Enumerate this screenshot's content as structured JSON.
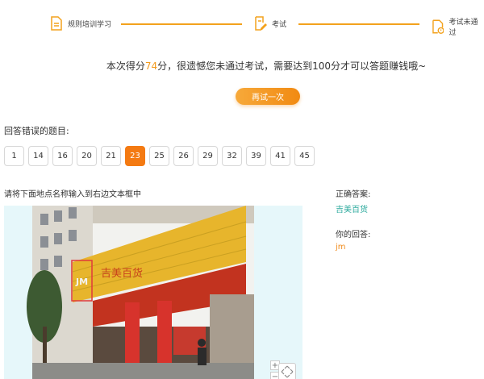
{
  "steps": [
    {
      "label": "规则培训学习"
    },
    {
      "label": "考试"
    },
    {
      "label": "考试未通过"
    }
  ],
  "result": {
    "prefix": "本次得分",
    "score": "74",
    "suffix": "分，很遗憾您未通过考试，需要达到100分才可以答题赚钱哦~",
    "retry_label": "再试一次"
  },
  "wrong": {
    "title": "回答错误的题目:",
    "items": [
      "1",
      "14",
      "16",
      "20",
      "21",
      "23",
      "25",
      "26",
      "29",
      "32",
      "39",
      "41",
      "45"
    ],
    "active": "23"
  },
  "question": {
    "prompt": "请将下面地点名称输入到右边文本框中",
    "sign_text": "吉美百货",
    "highlight_text": "JM"
  },
  "answer": {
    "correct_label": "正确答案:",
    "correct_value": "吉美百货",
    "user_label": "你的回答:",
    "user_value": "jm"
  },
  "map_controls": {
    "zoom_in": "+",
    "zoom_out": "−"
  },
  "colors": {
    "accent": "#f39a1c",
    "active": "#f47a12",
    "teal": "#2aa99c"
  },
  "icons": [
    "document-icon",
    "edit-icon",
    "doc-alert-icon",
    "pan-arrows-icon"
  ]
}
